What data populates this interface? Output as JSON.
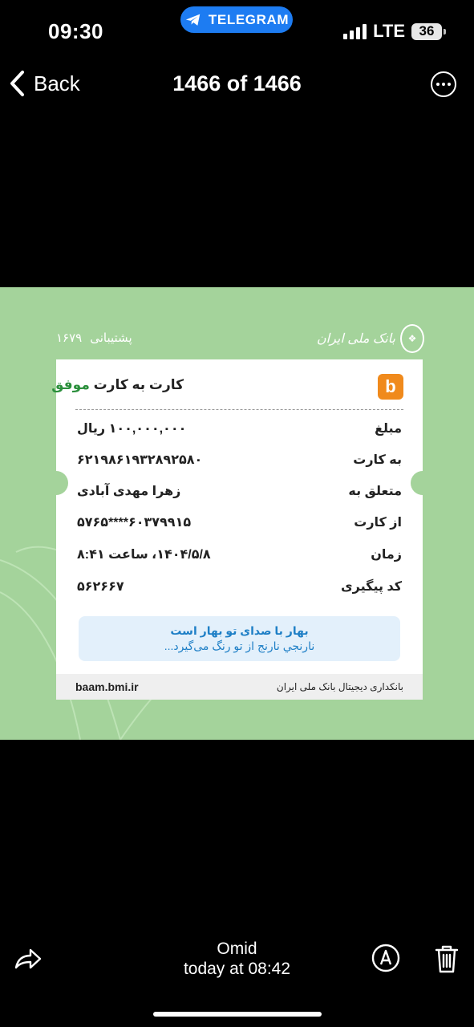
{
  "status_bar": {
    "time": "09:30",
    "app_pill": "TELEGRAM",
    "network": "LTE",
    "battery": "36"
  },
  "nav": {
    "back_label": "Back",
    "title": "1466 of 1466"
  },
  "receipt": {
    "support_label": "پشتیبانی",
    "support_number": "۱۶۷۹",
    "bank_logo_text": "بانک ملی ایران",
    "title": "کارت به کارت",
    "status": "موفق",
    "rows": [
      {
        "label": "مبلغ",
        "value": "۱۰۰,۰۰۰,۰۰۰ ریال"
      },
      {
        "label": "به کارت",
        "value": "۶۲۱۹۸۶۱۹۳۲۸۹۲۵۸۰"
      },
      {
        "label": "متعلق به",
        "value": "زهرا مهدی آبادی"
      },
      {
        "label": "از کارت",
        "value": "۶۰۳۷۹۹۱۵****۵۷۶۵"
      },
      {
        "label": "زمان",
        "value": "۱۴۰۴/۵/۸، ساعت ۸:۴۱"
      },
      {
        "label": "کد پیگیری",
        "value": "۵۶۲۶۶۷"
      }
    ],
    "message_line1": "بهار با صدای تو بهار است",
    "message_line2": "نارنجي نارنج از تو رنگ می‌گیرد...",
    "footer_site": "baam.bmi.ir",
    "footer_bank": "بانکداری دیجیتال بانک ملی ایران"
  },
  "bottom": {
    "sender": "Omid",
    "timestamp": "today at 08:42"
  },
  "colors": {
    "accent_blue": "#1d7cf2",
    "receipt_bg": "#a4d39b",
    "success_green": "#2b8f3c",
    "logo_orange": "#f08a1c"
  },
  "icons": [
    "telegram-icon",
    "chevron-left-icon",
    "more-icon",
    "share-icon",
    "markup-icon",
    "trash-icon"
  ]
}
